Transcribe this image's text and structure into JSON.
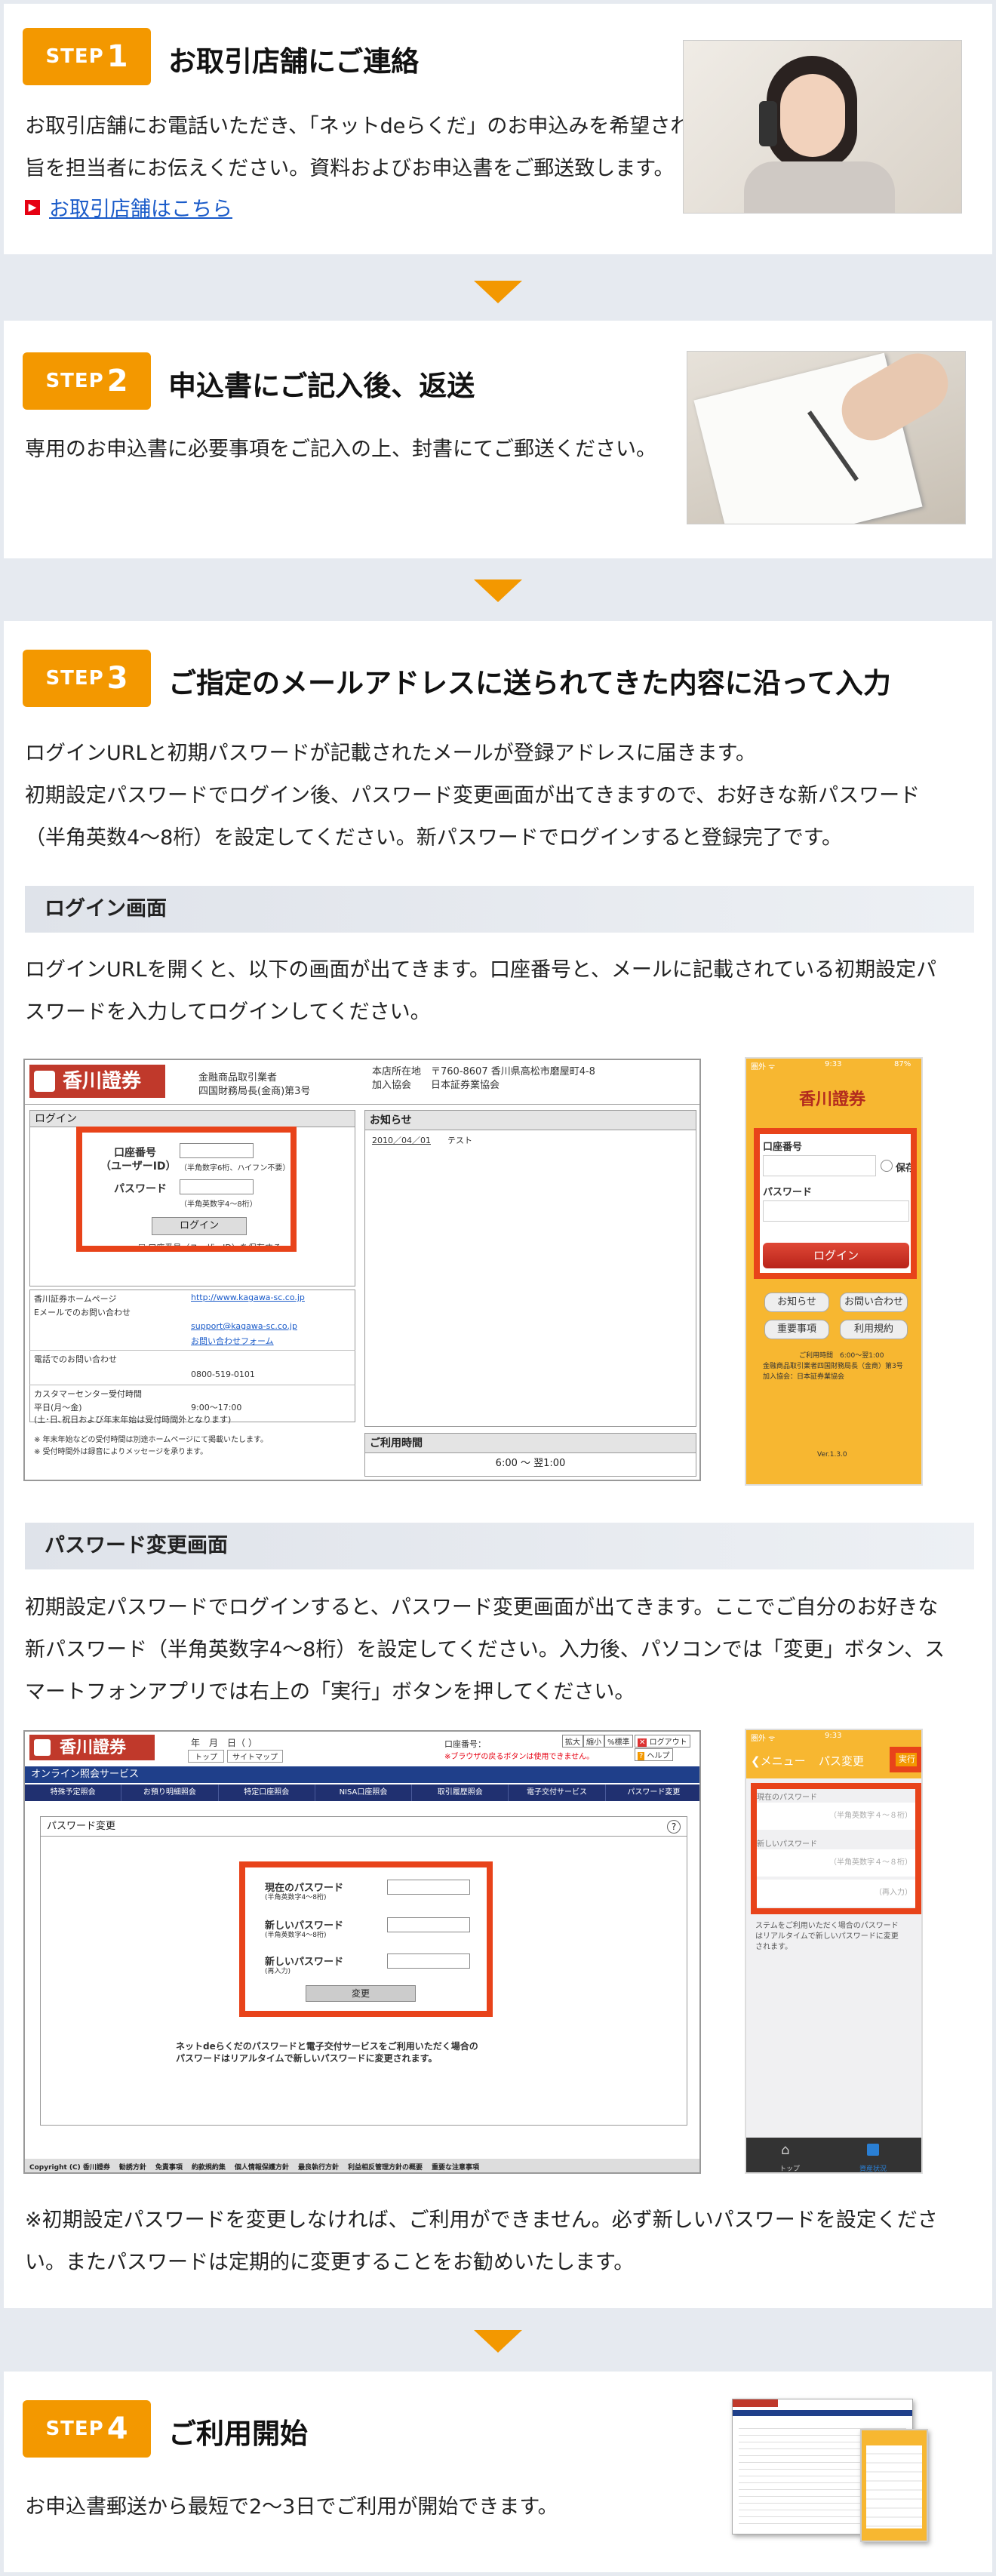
{
  "step1": {
    "step_word": "STEP",
    "step_num": "1",
    "title": "お取引店舗にご連絡",
    "text1": "お取引店舗にお電話いただき、「ネットdeらくだ」のお申込みを希望される",
    "text2": "旨を担当者にお伝えください。資料およびお申込書をご郵送致します。",
    "link": "お取引店舗はこちら"
  },
  "step2": {
    "step_word": "STEP",
    "step_num": "2",
    "title": "申込書にご記入後、返送",
    "text1": "専用のお申込書に必要事項をご記入の上、封書にてご郵送ください。"
  },
  "step3": {
    "step_word": "STEP",
    "step_num": "3",
    "title": "ご指定のメールアドレスに送られてきた内容に沿って入力",
    "text1": "ログインURLと初期パスワードが記載されたメールが登録アドレスに届きます。",
    "text2": "初期設定パスワードでログイン後、パスワード変更画面が出てきますので、お好きな新パスワード",
    "text3": "（半角英数4～8桁）を設定してください。新パスワードでログインすると登録完了です。",
    "login_heading": "ログイン画面",
    "login_text1": "ログインURLを開くと、以下の画面が出てきます。口座番号と、メールに記載されている初期設定パ",
    "login_text2": "スワードを入力してログインしてください。",
    "pw_heading": "パスワード変更画面",
    "pw_text1": "初期設定パスワードでログインすると、パスワード変更画面が出てきます。ここでご自分のお好きな",
    "pw_text2": "新パスワード（半角英数字4～8桁）を設定してください。入力後、パソコンでは「変更」ボタン、ス",
    "pw_text3": "マートフォンアプリでは右上の「実行」ボタンを押してください。",
    "note1": "※初期設定パスワードを変更しなければ、ご利用ができません。必ず新しいパスワードを設定くださ",
    "note2": "い。またパスワードは定期的に変更することをお勧めいたします。"
  },
  "step4": {
    "step_word": "STEP",
    "step_num": "4",
    "title": "ご利用開始",
    "text1": "お申込書郵送から最短で2～3日でご利用が開始できます。"
  },
  "login_pc": {
    "brand": "香川證券",
    "reg1": "金融商品取引業者",
    "reg2": "四国財務局長(金商)第3号",
    "addr1": "本店所在地　〒760-8607 香川県高松市磨屋町4-8",
    "addr2": "加入協会　　日本証券業協会",
    "login_tab": "ログイン",
    "account_label": "口座番号",
    "user_id_label": "（ユーザーID）",
    "account_hint": "（半角数字6桁、ハイフン不要）",
    "password_label": "パスワード",
    "password_hint": "（半角英数字4～8桁）",
    "login_button": "ログイン",
    "save_check": "口座番号（ユーザーID）を保存する",
    "news_tab": "お知らせ",
    "news_date": "2010／04／01",
    "news_text": "テスト",
    "hp_label": "香川証券ホームページ",
    "hp_url": "http://www.kagawa-sc.co.jp",
    "mail_label": "Eメールでのお問い合わせ",
    "mail_addr": "support@kagawa-sc.co.jp",
    "mail_form": "お問い合わせフォーム",
    "tel_label": "電話でのお問い合わせ",
    "tel_num": "0800-519-0101",
    "cc_label": "カスタマーセンター受付時間",
    "cc_hours_label": "平日(月～金)",
    "cc_hours": "9:00～17:00",
    "cc_note": "(土･日､祝日および年末年始は受付時間外となります)",
    "foot1": "※ 年末年始などの受付時間は別途ホームページにて掲載いたします。",
    "foot2": "※ 受付時間外は録音によりメッセージを承ります。",
    "usage_tab": "ご利用時間",
    "usage_time": "6:00 ～ 翌1:00"
  },
  "login_app": {
    "status_left": "圏外 ᯤ",
    "status_time": "9:33",
    "status_right": "87%",
    "brand": "香川證券",
    "account_label": "口座番号",
    "save_label": "保存",
    "password_label": "パスワード",
    "login_button": "ログイン",
    "btn1": "お知らせ",
    "btn2": "お問い合わせ",
    "btn3": "重要事項",
    "btn4": "利用規約",
    "info1": "ご利用時間　6:00～翌1:00",
    "info2": "金融商品取引業者四国財務局長（金商）第3号",
    "info3": "加入協会：日本証券業協会",
    "version": "Ver.1.3.0"
  },
  "pw_pc": {
    "brand": "香川證券",
    "date": "年　月　日（ ）",
    "tab_top": "トップ",
    "tab_sitemap": "サイトマップ",
    "account_label": "口座番号：",
    "browser_note": "※ブラウザの戻るボタンは使用できません。",
    "size_big": "拡大",
    "size_small": "縮小",
    "size_pct": "%標準",
    "logout": "ログアウト",
    "help": "ヘルプ",
    "service": "オンライン照会サービス",
    "nav": [
      "特殊予定照会",
      "お預り明細照会",
      "特定口座照会",
      "NISA口座照会",
      "取引履歴照会",
      "電子交付サービス",
      "パスワード変更"
    ],
    "panel_title": "パスワード変更",
    "help_icon": "?",
    "current_label": "現在のパスワード",
    "current_hint": "(半角英数字4～8桁)",
    "new_label": "新しいパスワード",
    "new_hint": "(半角英数字4～8桁)",
    "new2_label": "新しいパスワード",
    "new2_hint": "(再入力)",
    "change_button": "変更",
    "note1": "ネットdeらくだのパスワードと電子交付サービスをご利用いただく場合の",
    "note2": "パスワードはリアルタイムで新しいパスワードに変更されます。",
    "footer": [
      "Copyright (C) 香川證券",
      "勧誘方針",
      "免責事項",
      "約款規約集",
      "個人情報保護方針",
      "最良執行方針",
      "利益相反管理方針の概要",
      "重要な注意事項"
    ]
  },
  "pw_app": {
    "status_left": "圏外 ᯤ",
    "status_time": "9:33",
    "back": "メニュー",
    "title": "パス変更",
    "execute": "実行",
    "current_label": "現在のパスワード",
    "current_ph": "（半角英数字４～８桁）",
    "new_label": "新しいパスワード",
    "new_ph": "（半角英数字４～８桁）",
    "new2_ph": "（再入力）",
    "note1": "ステムをご利用いただく場合のパスワード",
    "note2": "はリアルタイムで新しいパスワードに変更",
    "note3": "されます。",
    "tab1": "トップ",
    "tab2": "資産状況"
  }
}
